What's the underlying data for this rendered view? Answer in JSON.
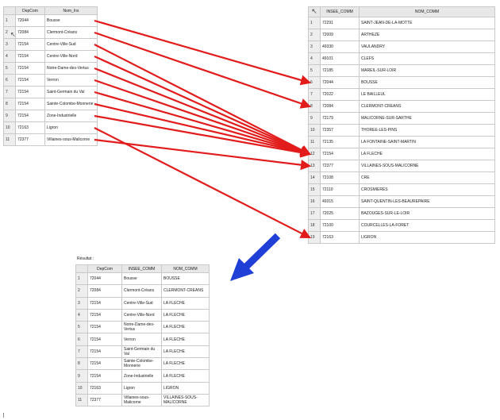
{
  "left_table": {
    "headers": [
      "",
      "DepCom",
      "Nom_Ins"
    ],
    "rows": [
      [
        "1",
        "72044",
        "Bousse"
      ],
      [
        "2",
        "72084",
        "Clermont-Créans"
      ],
      [
        "3",
        "72154",
        "Centre-Ville-Sud"
      ],
      [
        "4",
        "72154",
        "Centre-Ville-Nord"
      ],
      [
        "5",
        "72154",
        "Notre-Dame-des-Vertus"
      ],
      [
        "6",
        "72154",
        "Verron"
      ],
      [
        "7",
        "72154",
        "Saint-Germain du Val"
      ],
      [
        "8",
        "72154",
        "Sainte-Colombe-Monnerie"
      ],
      [
        "9",
        "72154",
        "Zone-Industrielle"
      ],
      [
        "10",
        "72163",
        "Ligron"
      ],
      [
        "11",
        "72377",
        "Villaines-sous-Malicorne"
      ]
    ]
  },
  "right_table": {
    "headers": [
      "",
      "INSEE_COMM",
      "NOM_COMM"
    ],
    "rows": [
      [
        "1",
        "72291",
        "SAINT-JEAN-DE-LA-MOTTE"
      ],
      [
        "2",
        "72009",
        "ARTHEZE"
      ],
      [
        "3",
        "49330",
        "VAULANDRY"
      ],
      [
        "4",
        "49101",
        "CLEFS"
      ],
      [
        "5",
        "72185",
        "MAREIL-SUR-LOIR"
      ],
      [
        "6",
        "72044",
        "BOUSSE"
      ],
      [
        "7",
        "72022",
        "LE BAILLEUL"
      ],
      [
        "8",
        "72084",
        "CLERMONT-CREANS"
      ],
      [
        "9",
        "72179",
        "MALICORNE-SUR-SARTHE"
      ],
      [
        "10",
        "72357",
        "THOREE-LES-PINS"
      ],
      [
        "11",
        "72135",
        "LA FONTAINE-SAINT-MARTIN"
      ],
      [
        "12",
        "72154",
        "LA FLECHE"
      ],
      [
        "13",
        "72377",
        "VILLAINES-SOUS-MALICORNE"
      ],
      [
        "14",
        "72108",
        "CRE"
      ],
      [
        "15",
        "72110",
        "CROSMIERES"
      ],
      [
        "16",
        "49315",
        "SAINT-QUENTIN-LES-BEAUREPAIRE"
      ],
      [
        "17",
        "72025",
        "BAZOUGES-SUR-LE-LOIR"
      ],
      [
        "18",
        "72100",
        "COURCELLES-LA-FORET"
      ],
      [
        "19",
        "72163",
        "LIGRON"
      ]
    ]
  },
  "result": {
    "label": "Résultat :",
    "headers": [
      "",
      "DepCom",
      "INSEE_COMM",
      "NOM_COMM"
    ],
    "rows": [
      [
        "1",
        "72044",
        "Bousse",
        "BOUSSE"
      ],
      [
        "2",
        "72084",
        "Clermont-Créans",
        "CLERMONT-CREANS"
      ],
      [
        "3",
        "72154",
        "Centre-Ville-Sud",
        "LA FLECHE"
      ],
      [
        "4",
        "72154",
        "Centre-Ville-Nord",
        "LA FLECHE"
      ],
      [
        "5",
        "72154",
        "Notre-Dame-des-Vertus",
        "LA FLECHE"
      ],
      [
        "6",
        "72154",
        "Verron",
        "LA FLECHE"
      ],
      [
        "7",
        "72154",
        "Saint-Germain du Val",
        "LA FLECHE"
      ],
      [
        "8",
        "72154",
        "Sainte-Colombe-Monnerie",
        "LA FLECHE"
      ],
      [
        "9",
        "72154",
        "Zone-Industrielle",
        "LA FLECHE"
      ],
      [
        "10",
        "72163",
        "Ligron",
        "LIGRON"
      ],
      [
        "11",
        "72377",
        "Villaines-sous-Malicorne",
        "VILLAINES-SOUS-MALICORNE"
      ]
    ]
  },
  "join_links": [
    {
      "from": 1,
      "to": 6
    },
    {
      "from": 2,
      "to": 8
    },
    {
      "from": 3,
      "to": 12
    },
    {
      "from": 4,
      "to": 12
    },
    {
      "from": 5,
      "to": 12
    },
    {
      "from": 6,
      "to": 12
    },
    {
      "from": 7,
      "to": 12
    },
    {
      "from": 8,
      "to": 12
    },
    {
      "from": 9,
      "to": 12
    },
    {
      "from": 10,
      "to": 19
    },
    {
      "from": 11,
      "to": 13
    }
  ],
  "colors": {
    "link_arrow": "#e21b1b",
    "result_arrow": "#1f3fd6",
    "header_bg": "#e8e8e8",
    "grid_line": "#c9c9c9"
  },
  "icons": {
    "cursor": "mouse-pointer-icon",
    "right_header_corner": "cursor-icon"
  }
}
